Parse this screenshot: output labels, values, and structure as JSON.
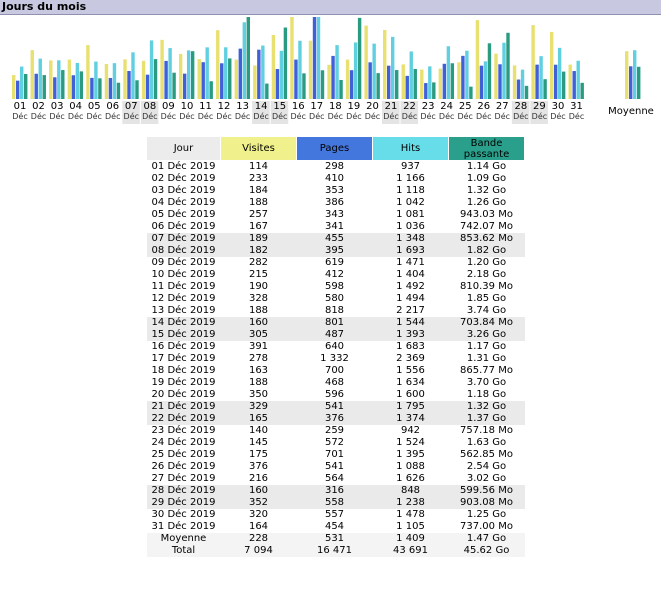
{
  "section_title": "Jours du mois",
  "colors": {
    "visites": "#e8e070",
    "pages": "#4060d8",
    "hits": "#60d0e0",
    "bandwidth": "#2a9a80"
  },
  "chart_data": {
    "type": "bar",
    "title": "Jours du mois",
    "categories": [
      "01",
      "02",
      "03",
      "04",
      "05",
      "06",
      "07",
      "08",
      "09",
      "10",
      "11",
      "12",
      "13",
      "14",
      "15",
      "16",
      "17",
      "18",
      "19",
      "20",
      "21",
      "22",
      "23",
      "24",
      "25",
      "26",
      "27",
      "28",
      "29",
      "30",
      "31"
    ],
    "month_label": "Déc",
    "average_label": "Moyenne",
    "series": [
      {
        "name": "Visites",
        "values": [
          114,
          233,
          184,
          188,
          257,
          167,
          189,
          182,
          282,
          215,
          190,
          328,
          188,
          160,
          305,
          391,
          278,
          163,
          188,
          350,
          329,
          165,
          140,
          145,
          175,
          376,
          216,
          160,
          352,
          320,
          164
        ],
        "average": 228
      },
      {
        "name": "Pages",
        "values": [
          298,
          410,
          353,
          386,
          343,
          341,
          455,
          395,
          619,
          412,
          598,
          580,
          818,
          801,
          487,
          640,
          1332,
          700,
          468,
          596,
          541,
          376,
          259,
          572,
          701,
          541,
          564,
          316,
          558,
          557,
          454
        ],
        "average": 531
      },
      {
        "name": "Hits",
        "values": [
          937,
          1166,
          1118,
          1042,
          1081,
          1036,
          1348,
          1693,
          1471,
          1404,
          1492,
          1494,
          2217,
          1544,
          1393,
          1683,
          2369,
          1556,
          1634,
          1600,
          1795,
          1374,
          942,
          1524,
          1395,
          1088,
          1626,
          848,
          1238,
          1478,
          1105
        ],
        "average": 1409
      },
      {
        "name": "Bande passante",
        "unit": "Go",
        "values": [
          1.14,
          1.09,
          1.32,
          1.26,
          0.943,
          0.742,
          0.854,
          1.82,
          1.2,
          2.18,
          0.81,
          1.85,
          3.74,
          0.704,
          3.26,
          1.17,
          1.31,
          0.866,
          3.7,
          1.18,
          1.32,
          1.37,
          0.757,
          1.63,
          0.563,
          2.54,
          3.02,
          0.6,
          0.903,
          1.25,
          0.737
        ],
        "average": 1.47
      }
    ]
  },
  "table": {
    "headers": {
      "day": "Jour",
      "visites": "Visites",
      "pages": "Pages",
      "hits": "Hits",
      "bandwidth_line1": "Bande",
      "bandwidth_line2": "passante"
    },
    "rows": [
      {
        "day": "01 Déc 2019",
        "visites": "114",
        "pages": "298",
        "hits": "937",
        "bandwidth": "1.14 Go",
        "weekend": false
      },
      {
        "day": "02 Déc 2019",
        "visites": "233",
        "pages": "410",
        "hits": "1 166",
        "bandwidth": "1.09 Go",
        "weekend": false
      },
      {
        "day": "03 Déc 2019",
        "visites": "184",
        "pages": "353",
        "hits": "1 118",
        "bandwidth": "1.32 Go",
        "weekend": false
      },
      {
        "day": "04 Déc 2019",
        "visites": "188",
        "pages": "386",
        "hits": "1 042",
        "bandwidth": "1.26 Go",
        "weekend": false
      },
      {
        "day": "05 Déc 2019",
        "visites": "257",
        "pages": "343",
        "hits": "1 081",
        "bandwidth": "943.03 Mo",
        "weekend": false
      },
      {
        "day": "06 Déc 2019",
        "visites": "167",
        "pages": "341",
        "hits": "1 036",
        "bandwidth": "742.07 Mo",
        "weekend": false
      },
      {
        "day": "07 Déc 2019",
        "visites": "189",
        "pages": "455",
        "hits": "1 348",
        "bandwidth": "853.62 Mo",
        "weekend": true
      },
      {
        "day": "08 Déc 2019",
        "visites": "182",
        "pages": "395",
        "hits": "1 693",
        "bandwidth": "1.82 Go",
        "weekend": true
      },
      {
        "day": "09 Déc 2019",
        "visites": "282",
        "pages": "619",
        "hits": "1 471",
        "bandwidth": "1.20 Go",
        "weekend": false
      },
      {
        "day": "10 Déc 2019",
        "visites": "215",
        "pages": "412",
        "hits": "1 404",
        "bandwidth": "2.18 Go",
        "weekend": false
      },
      {
        "day": "11 Déc 2019",
        "visites": "190",
        "pages": "598",
        "hits": "1 492",
        "bandwidth": "810.39 Mo",
        "weekend": false
      },
      {
        "day": "12 Déc 2019",
        "visites": "328",
        "pages": "580",
        "hits": "1 494",
        "bandwidth": "1.85 Go",
        "weekend": false
      },
      {
        "day": "13 Déc 2019",
        "visites": "188",
        "pages": "818",
        "hits": "2 217",
        "bandwidth": "3.74 Go",
        "weekend": false
      },
      {
        "day": "14 Déc 2019",
        "visites": "160",
        "pages": "801",
        "hits": "1 544",
        "bandwidth": "703.84 Mo",
        "weekend": true
      },
      {
        "day": "15 Déc 2019",
        "visites": "305",
        "pages": "487",
        "hits": "1 393",
        "bandwidth": "3.26 Go",
        "weekend": true
      },
      {
        "day": "16 Déc 2019",
        "visites": "391",
        "pages": "640",
        "hits": "1 683",
        "bandwidth": "1.17 Go",
        "weekend": false
      },
      {
        "day": "17 Déc 2019",
        "visites": "278",
        "pages": "1 332",
        "hits": "2 369",
        "bandwidth": "1.31 Go",
        "weekend": false
      },
      {
        "day": "18 Déc 2019",
        "visites": "163",
        "pages": "700",
        "hits": "1 556",
        "bandwidth": "865.77 Mo",
        "weekend": false
      },
      {
        "day": "19 Déc 2019",
        "visites": "188",
        "pages": "468",
        "hits": "1 634",
        "bandwidth": "3.70 Go",
        "weekend": false
      },
      {
        "day": "20 Déc 2019",
        "visites": "350",
        "pages": "596",
        "hits": "1 600",
        "bandwidth": "1.18 Go",
        "weekend": false
      },
      {
        "day": "21 Déc 2019",
        "visites": "329",
        "pages": "541",
        "hits": "1 795",
        "bandwidth": "1.32 Go",
        "weekend": true
      },
      {
        "day": "22 Déc 2019",
        "visites": "165",
        "pages": "376",
        "hits": "1 374",
        "bandwidth": "1.37 Go",
        "weekend": true
      },
      {
        "day": "23 Déc 2019",
        "visites": "140",
        "pages": "259",
        "hits": "942",
        "bandwidth": "757.18 Mo",
        "weekend": false
      },
      {
        "day": "24 Déc 2019",
        "visites": "145",
        "pages": "572",
        "hits": "1 524",
        "bandwidth": "1.63 Go",
        "weekend": false
      },
      {
        "day": "25 Déc 2019",
        "visites": "175",
        "pages": "701",
        "hits": "1 395",
        "bandwidth": "562.85 Mo",
        "weekend": false
      },
      {
        "day": "26 Déc 2019",
        "visites": "376",
        "pages": "541",
        "hits": "1 088",
        "bandwidth": "2.54 Go",
        "weekend": false
      },
      {
        "day": "27 Déc 2019",
        "visites": "216",
        "pages": "564",
        "hits": "1 626",
        "bandwidth": "3.02 Go",
        "weekend": false
      },
      {
        "day": "28 Déc 2019",
        "visites": "160",
        "pages": "316",
        "hits": "848",
        "bandwidth": "599.56 Mo",
        "weekend": true
      },
      {
        "day": "29 Déc 2019",
        "visites": "352",
        "pages": "558",
        "hits": "1 238",
        "bandwidth": "903.08 Mo",
        "weekend": true
      },
      {
        "day": "30 Déc 2019",
        "visites": "320",
        "pages": "557",
        "hits": "1 478",
        "bandwidth": "1.25 Go",
        "weekend": false
      },
      {
        "day": "31 Déc 2019",
        "visites": "164",
        "pages": "454",
        "hits": "1 105",
        "bandwidth": "737.00 Mo",
        "weekend": false
      }
    ],
    "average": {
      "label": "Moyenne",
      "visites": "228",
      "pages": "531",
      "hits": "1 409",
      "bandwidth": "1.47 Go"
    },
    "total": {
      "label": "Total",
      "visites": "7 094",
      "pages": "16 471",
      "hits": "43 691",
      "bandwidth": "45.62 Go"
    }
  }
}
